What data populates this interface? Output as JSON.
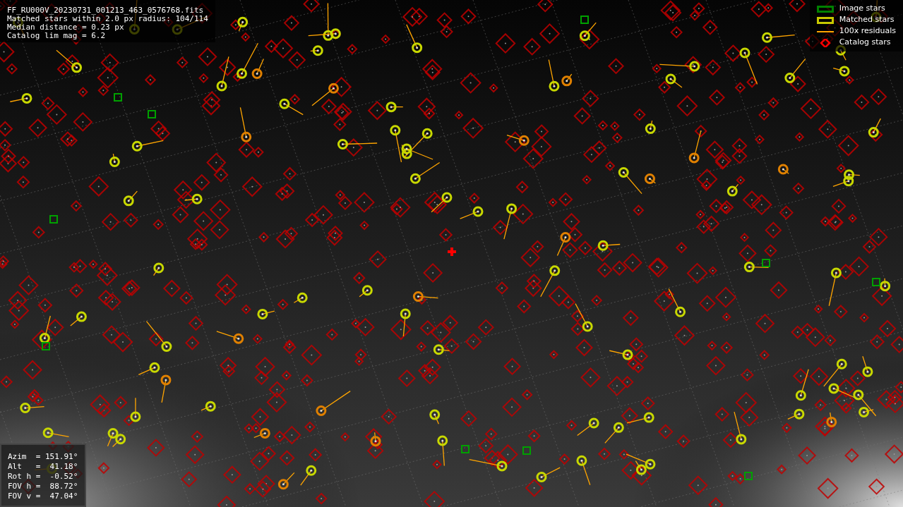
{
  "info": [
    "FF_RU000V_20230731_001213_463_0576768.fits",
    "Matched stars within 2.0 px radius: 104/114",
    "Median distance = 0.23 px",
    "Catalog lim mag = 6.2"
  ],
  "legend": [
    {
      "kind": "box",
      "label": "Image stars",
      "color": "#008000"
    },
    {
      "kind": "box",
      "label": "Matched stars",
      "color": "#c8c800"
    },
    {
      "kind": "line",
      "label": "100x residuals",
      "color": "#ffa500"
    },
    {
      "kind": "diamond",
      "label": "Catalog stars",
      "color": "#ff0000"
    }
  ],
  "pointing": [
    "Azim  = 151.91°",
    "Alt   =  41.18°",
    "Rot h =  -0.52°",
    "FOV h =  88.72°",
    "FOV v =  47.04°"
  ]
}
